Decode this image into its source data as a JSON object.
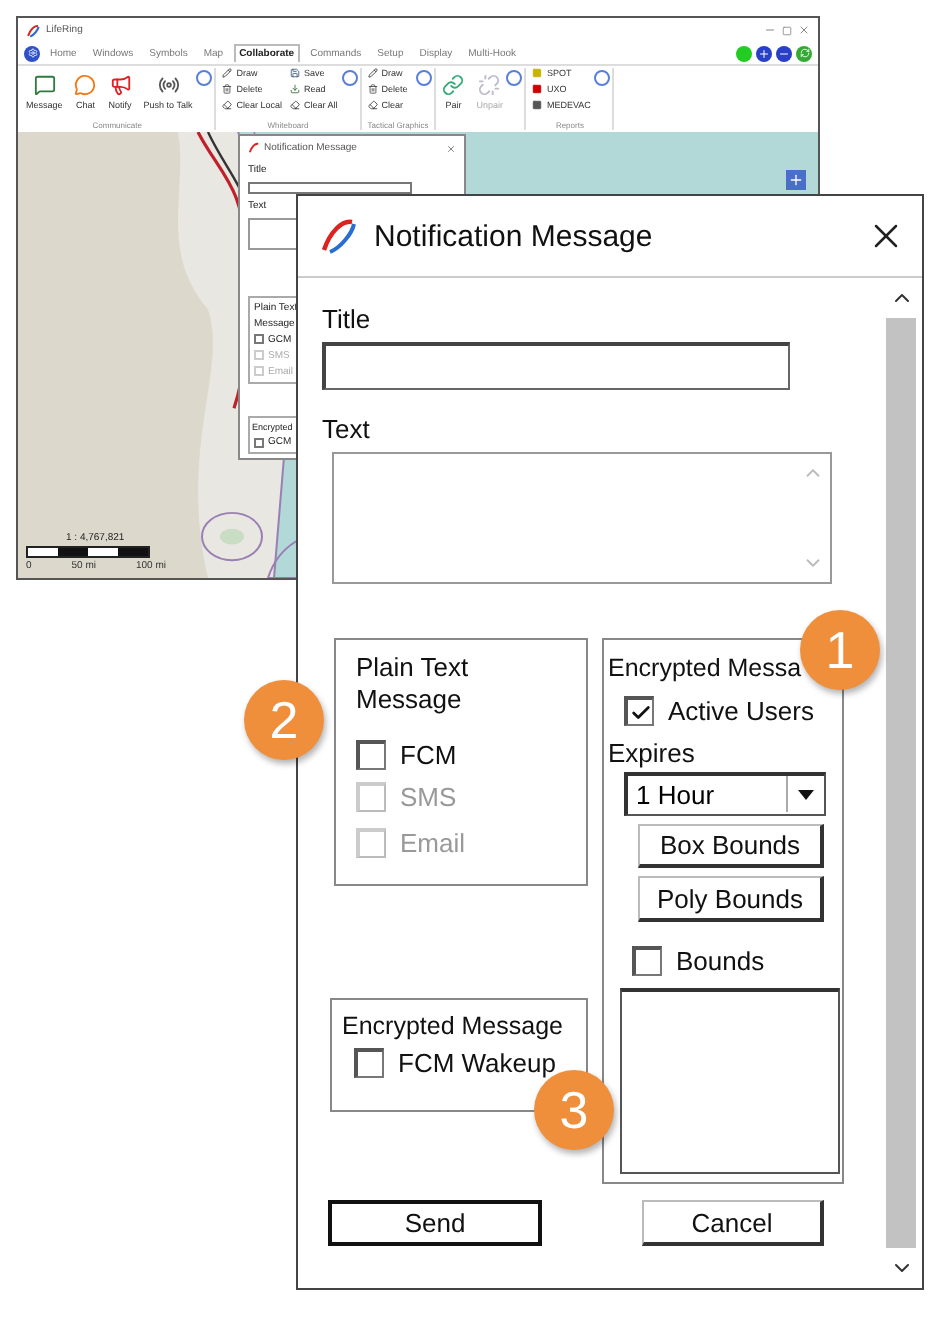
{
  "app_window": {
    "title": "LifeRing",
    "menu_tabs": [
      {
        "label": "Home",
        "selected": false
      },
      {
        "label": "Windows",
        "selected": false
      },
      {
        "label": "Symbols",
        "selected": false
      },
      {
        "label": "Map",
        "selected": false
      },
      {
        "label": "Collaborate",
        "selected": true
      },
      {
        "label": "Commands",
        "selected": false
      },
      {
        "label": "Setup",
        "selected": false
      },
      {
        "label": "Display",
        "selected": false
      },
      {
        "label": "Multi-Hook",
        "selected": false
      }
    ],
    "ribbon_groups": [
      {
        "label": "Communicate",
        "kind": "large",
        "items": [
          {
            "label": "Message",
            "disabled": false
          },
          {
            "label": "Chat",
            "disabled": false
          },
          {
            "label": "Notify",
            "disabled": false
          },
          {
            "label": "Push to Talk",
            "disabled": false
          }
        ]
      },
      {
        "label": "Whiteboard",
        "kind": "small",
        "items": [
          {
            "label": "Draw",
            "disabled": false
          },
          {
            "label": "Delete",
            "disabled": false
          },
          {
            "label": "Clear Local",
            "disabled": false
          },
          {
            "label": "Save",
            "disabled": false
          },
          {
            "label": "Read",
            "disabled": false
          },
          {
            "label": "Clear All",
            "disabled": false
          }
        ]
      },
      {
        "label": "Tactical Graphics",
        "kind": "small",
        "items": [
          {
            "label": "Draw",
            "disabled": false
          },
          {
            "label": "Delete",
            "disabled": false
          },
          {
            "label": "Clear",
            "disabled": false
          }
        ]
      },
      {
        "kind": "large",
        "items": [
          {
            "label": "Pair",
            "disabled": false
          },
          {
            "label": "Unpair",
            "disabled": true
          }
        ]
      },
      {
        "label": "Reports",
        "kind": "small",
        "items": [
          {
            "label": "SPOT",
            "disabled": false
          },
          {
            "label": "UXO",
            "disabled": false
          },
          {
            "label": "MEDEVAC",
            "disabled": false
          }
        ]
      }
    ],
    "map": {
      "scale": "1 : 4,767,821",
      "scale_labels": [
        "0",
        "50 mi",
        "100 mi"
      ]
    },
    "mini_dialog": {
      "title": "Notification Message",
      "title_label": "Title",
      "text_label": "Text",
      "plain_group": [
        "Plain Text",
        "Message"
      ],
      "options": [
        {
          "label": "GCM",
          "checked": false,
          "disabled": false
        },
        {
          "label": "SMS",
          "checked": false,
          "disabled": true
        },
        {
          "label": "Email",
          "checked": false,
          "disabled": true
        }
      ],
      "wakeup_group": "Encrypted",
      "wakeup_option": {
        "label": "GCM",
        "checked": false
      }
    }
  },
  "dialog": {
    "title": "Notification Message",
    "title_label": "Title",
    "text_label": "Text",
    "plain_group": {
      "title": "Plain Text Message",
      "options": [
        {
          "label": "FCM",
          "checked": false,
          "disabled": false
        },
        {
          "label": "SMS",
          "checked": false,
          "disabled": true
        },
        {
          "label": "Email",
          "checked": false,
          "disabled": true
        }
      ]
    },
    "wakeup_group": {
      "title": "Encrypted Message",
      "options": [
        {
          "label": "FCM Wakeup",
          "checked": false,
          "disabled": false
        }
      ]
    },
    "encrypted_group": {
      "title": "Encrypted Messa",
      "active_users": {
        "label": "Active Users",
        "checked": true
      },
      "expires_label": "Expires",
      "expires_value": "1 Hour",
      "buttons": [
        "Box Bounds",
        "Poly Bounds"
      ],
      "bounds": {
        "label": "Bounds",
        "checked": false
      }
    },
    "buttons": [
      {
        "label": "Send",
        "default": true
      },
      {
        "label": "Cancel",
        "default": false
      }
    ]
  },
  "callouts": [
    "1",
    "2",
    "3"
  ]
}
